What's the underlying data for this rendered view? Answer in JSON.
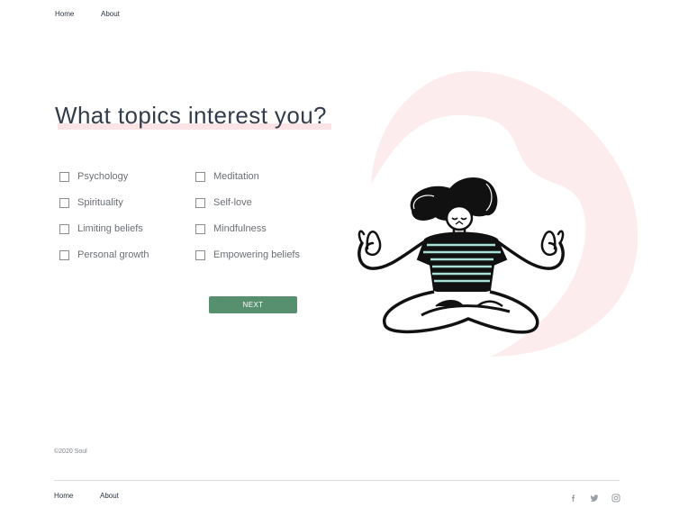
{
  "header": {
    "nav": [
      {
        "label": "Home"
      },
      {
        "label": "About"
      }
    ]
  },
  "main": {
    "title": "What topics interest you?",
    "topics_left": [
      {
        "label": "Psychology",
        "checked": false
      },
      {
        "label": "Spirituality",
        "checked": false
      },
      {
        "label": "Limiting beliefs",
        "checked": false
      },
      {
        "label": "Personal growth",
        "checked": false
      }
    ],
    "topics_right": [
      {
        "label": "Meditation",
        "checked": false
      },
      {
        "label": "Self-love",
        "checked": false
      },
      {
        "label": "Mindfulness",
        "checked": false
      },
      {
        "label": "Empowering beliefs",
        "checked": false
      }
    ],
    "next_label": "NEXT"
  },
  "colors": {
    "accent_green": "#56906f",
    "highlight_pink": "#fbe3e6",
    "blob_pink": "#fdeced",
    "illustration_stripe": "#a8e2d6"
  },
  "footer": {
    "copyright": "©2020 Soul",
    "nav": [
      {
        "label": "Home"
      },
      {
        "label": "About"
      }
    ],
    "social": [
      {
        "icon": "facebook-icon"
      },
      {
        "icon": "twitter-icon"
      },
      {
        "icon": "instagram-icon"
      }
    ]
  }
}
